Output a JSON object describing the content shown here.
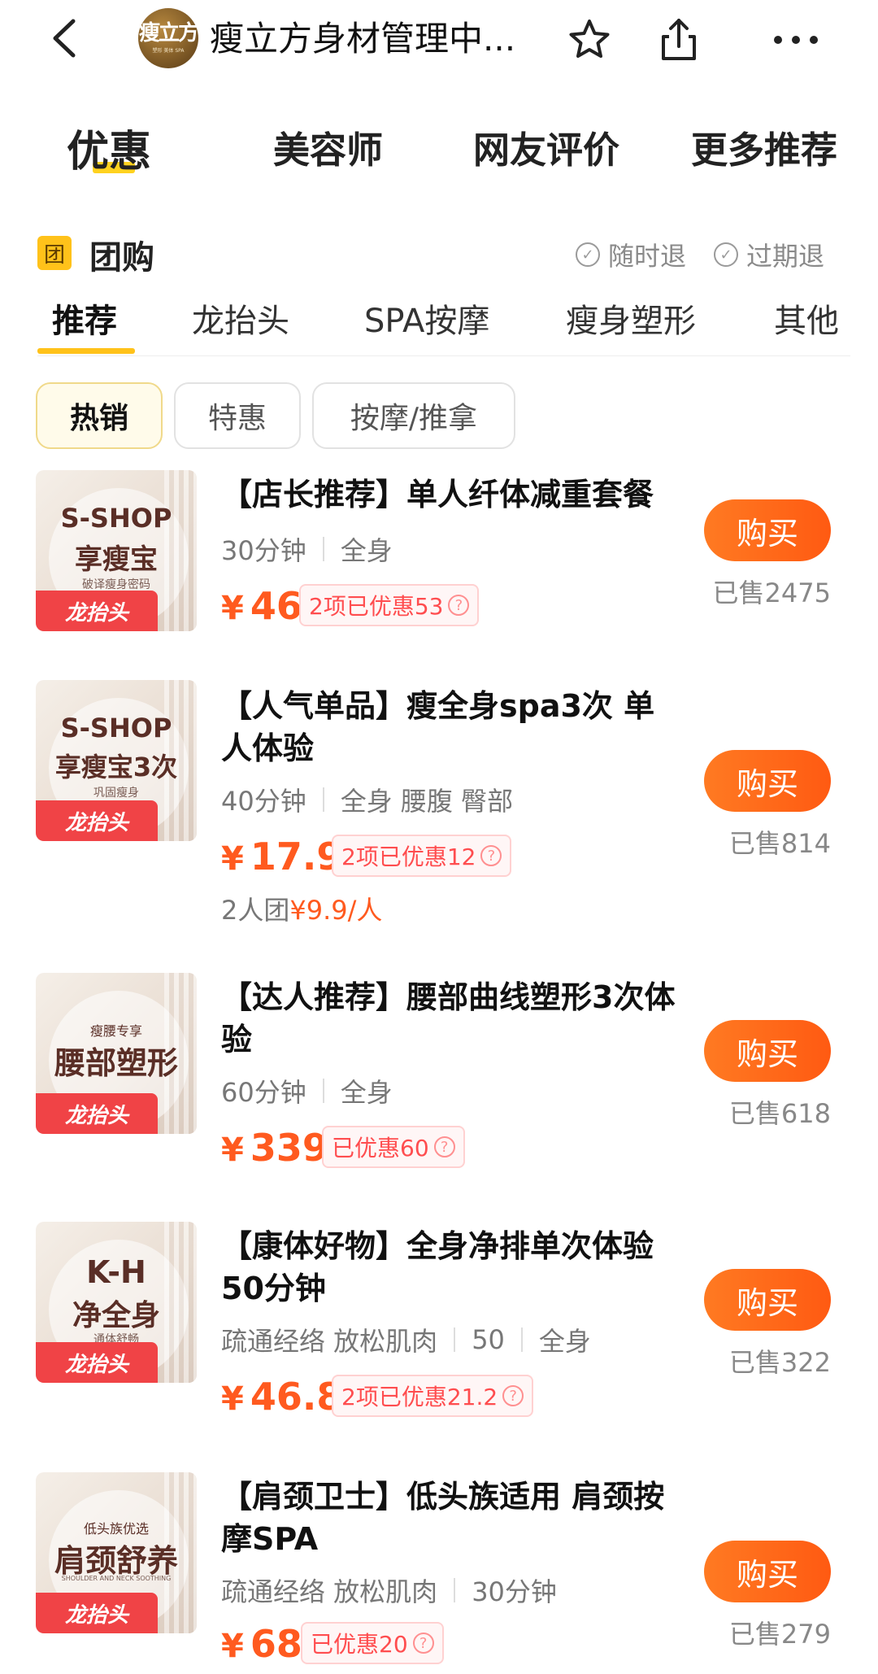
{
  "header": {
    "title": "瘦立方身材管理中...",
    "logo_text": "瘦立方",
    "logo_subtext": "塑形 美体 SPA",
    "icons": [
      "back-icon",
      "star-icon",
      "share-icon",
      "more-icon"
    ]
  },
  "main_tabs": [
    "优惠",
    "美容师",
    "网友评价",
    "更多推荐"
  ],
  "group_buy": {
    "badge": "团",
    "title": "团购",
    "guarantees": [
      "随时退",
      "过期退"
    ]
  },
  "category_tabs": [
    "推荐",
    "龙抬头",
    "SPA按摩",
    "瘦身塑形",
    "其他"
  ],
  "filter_chips": [
    "热销",
    "特惠",
    "按摩/推拿"
  ],
  "currency": "¥",
  "buy_label": "购买",
  "deals": [
    {
      "title": "【店长推荐】单人纤体减重套餐",
      "meta": [
        "30分钟",
        "全身"
      ],
      "price": "46",
      "discount": "2项已优惠53",
      "group": null,
      "sold": "已售2475",
      "thumb": {
        "line1": "S-SHOP",
        "line2": "享瘦宝",
        "small": "破译瘦身密码",
        "tag": "龙抬头"
      }
    },
    {
      "title": "【人气单品】瘦全身spa3次 单人体验",
      "meta": [
        "40分钟",
        "全身 腰腹 臀部"
      ],
      "price": "17.9",
      "discount": "2项已优惠12",
      "group": {
        "label": "2人团",
        "price": "¥9.9/人"
      },
      "sold": "已售814",
      "thumb": {
        "line1": "S-SHOP",
        "line2": "享瘦宝3次",
        "small": "巩固瘦身",
        "tag": "龙抬头"
      }
    },
    {
      "title": "【达人推荐】腰部曲线塑形3次体验",
      "meta": [
        "60分钟",
        "全身"
      ],
      "price": "339",
      "discount": "已优惠60",
      "group": null,
      "sold": "已售618",
      "thumb": {
        "line1": "瘦腰专享",
        "line2": "腰部塑形",
        "small": "",
        "tag": "龙抬头"
      }
    },
    {
      "title": "【康体好物】全身净排单次体验50分钟",
      "meta": [
        "疏通经络 放松肌肉",
        "50",
        "全身"
      ],
      "price": "46.8",
      "discount": "2项已优惠21.2",
      "group": null,
      "sold": "已售322",
      "thumb": {
        "line1": "K-H",
        "line2": "净全身",
        "small": "通体舒畅",
        "tag": "龙抬头"
      }
    },
    {
      "title": "【肩颈卫士】低头族适用 肩颈按摩SPA",
      "meta": [
        "疏通经络 放松肌肉",
        "30分钟"
      ],
      "price": "68",
      "discount": "已优惠20",
      "group": null,
      "sold": "已售279",
      "thumb": {
        "line1": "低头族优选",
        "line2": "肩颈舒养",
        "small": "SHOULDER AND NECK SOOTHING",
        "tag": "龙抬头"
      }
    }
  ]
}
